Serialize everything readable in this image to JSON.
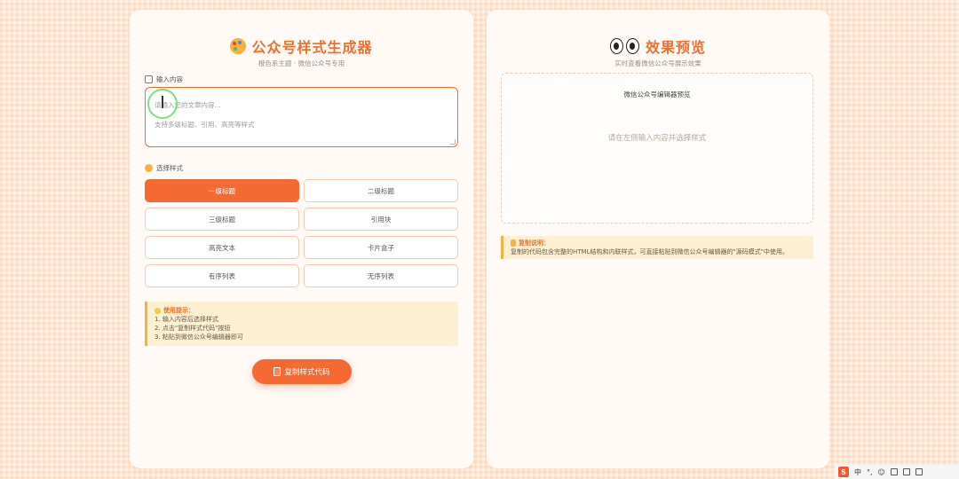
{
  "left_panel": {
    "title": "公众号样式生成器",
    "subtitle": "橙色系主题 · 微信公众号专用",
    "input_label": "输入内容",
    "textarea_lines": [
      "请输入您的文章内容...",
      "支持多级标题、引用、高亮等样式"
    ],
    "style_label": "选择样式",
    "styles": [
      {
        "label": "一级标题",
        "active": true
      },
      {
        "label": "二级标题",
        "active": false
      },
      {
        "label": "三级标题",
        "active": false
      },
      {
        "label": "引用块",
        "active": false
      },
      {
        "label": "高亮文本",
        "active": false
      },
      {
        "label": "卡片盒子",
        "active": false
      },
      {
        "label": "有序列表",
        "active": false
      },
      {
        "label": "无序列表",
        "active": false
      }
    ],
    "tips": {
      "title": "使用提示：",
      "lines": [
        "1. 输入内容后选择样式",
        "2. 点击\"复制样式代码\"按钮",
        "3. 粘贴到微信公众号编辑器即可"
      ]
    },
    "copy_button": "复制样式代码"
  },
  "right_panel": {
    "title": "效果预览",
    "subtitle": "实时查看微信公众号展示效果",
    "preview_header": "微信公众号编辑器预览",
    "preview_hint": "请在左侧输入内容并选择样式",
    "info": {
      "title": "复制说明：",
      "text": "复制的代码包含完整的HTML结构和内联样式，可直接粘贴到微信公众号编辑器的\"源码模式\"中使用。"
    }
  },
  "taskbar": {
    "items": [
      "中",
      "°,",
      "☺"
    ]
  },
  "colors": {
    "accent": "#f46a32",
    "title": "#f0712e",
    "tip_bg": "#fdf0d2",
    "tip_border": "#f2b34a"
  }
}
